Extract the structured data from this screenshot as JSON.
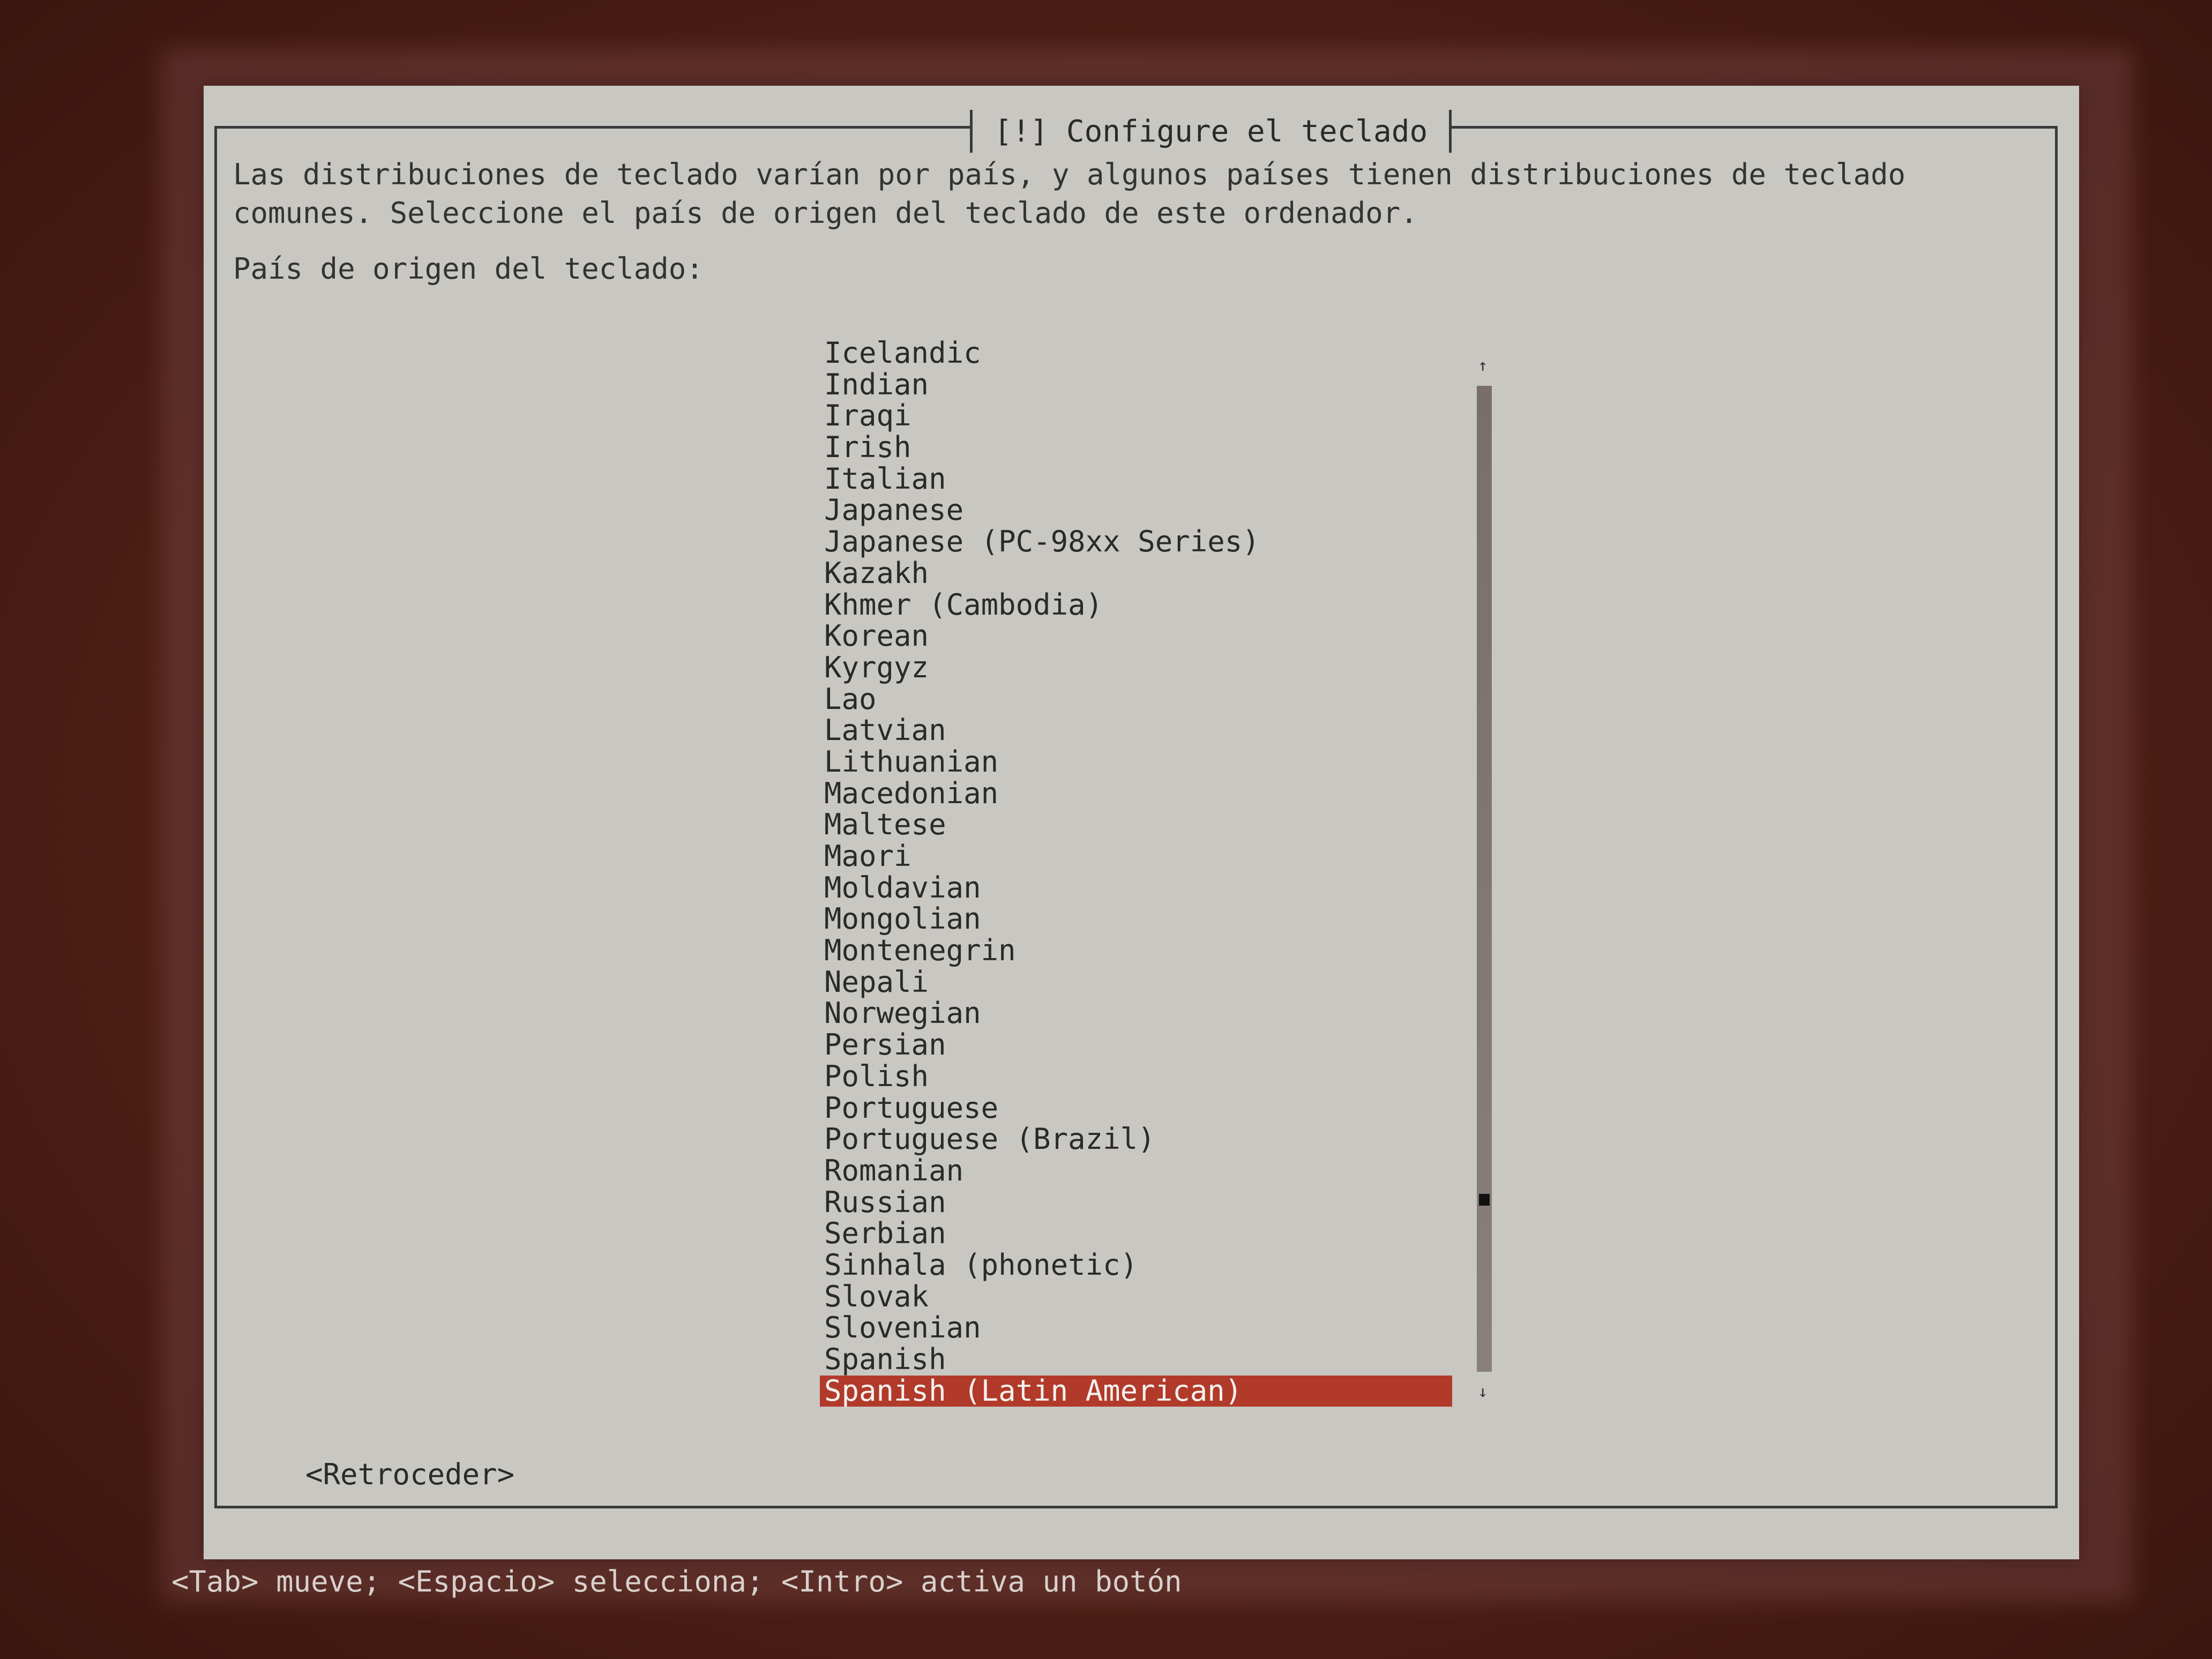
{
  "dialog": {
    "title": "[!] Configure el teclado",
    "description": "Las distribuciones de teclado varían por país, y algunos países tienen distribuciones de teclado comunes. Seleccione el país de origen del teclado de este ordenador.",
    "prompt": "País de origen del teclado:"
  },
  "list": {
    "items": [
      "Icelandic",
      "Indian",
      "Iraqi",
      "Irish",
      "Italian",
      "Japanese",
      "Japanese (PC-98xx Series)",
      "Kazakh",
      "Khmer (Cambodia)",
      "Korean",
      "Kyrgyz",
      "Lao",
      "Latvian",
      "Lithuanian",
      "Macedonian",
      "Maltese",
      "Maori",
      "Moldavian",
      "Mongolian",
      "Montenegrin",
      "Nepali",
      "Norwegian",
      "Persian",
      "Polish",
      "Portuguese",
      "Portuguese (Brazil)",
      "Romanian",
      "Russian",
      "Serbian",
      "Sinhala (phonetic)",
      "Slovak",
      "Slovenian",
      "Spanish",
      "Spanish (Latin American)"
    ],
    "selected": "Spanish (Latin American)"
  },
  "scrollbar": {
    "up_glyph": "↑",
    "down_glyph": "↓"
  },
  "buttons": {
    "back": "<Retroceder>"
  },
  "help": {
    "text": "<Tab> mueve; <Espacio> selecciona; <Intro> activa un botón"
  },
  "colors": {
    "dialog_bg": "#c9c7c2",
    "selection": "#b23a2a",
    "screen_bg": "#4f2015"
  }
}
